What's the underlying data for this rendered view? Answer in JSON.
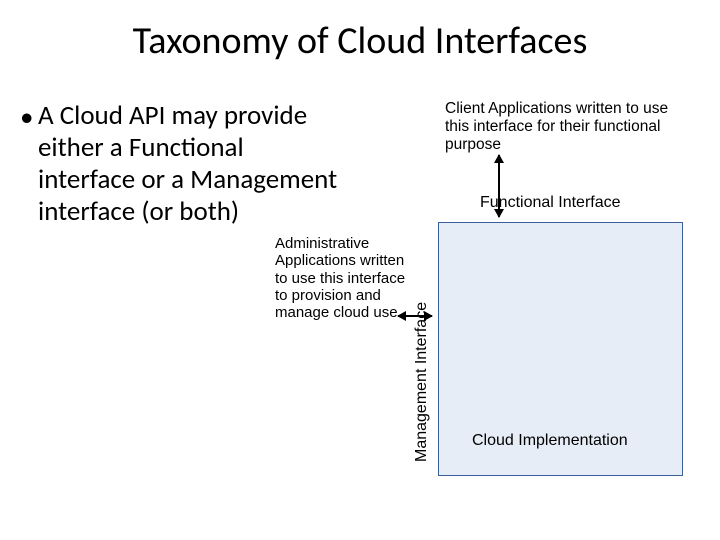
{
  "title": "Taxonomy of Cloud Interfaces",
  "bullet": "A Cloud API may provide either a Functional interface or a Management interface (or both)",
  "admin_text": "Administrative Applications written to use this interface to provision and manage cloud use",
  "client_text": "Client Applications written to use this interface for their functional purpose",
  "functional_label": "Functional  Interface",
  "management_label": "Management  Interface",
  "cloud_impl": "Cloud Implementation"
}
